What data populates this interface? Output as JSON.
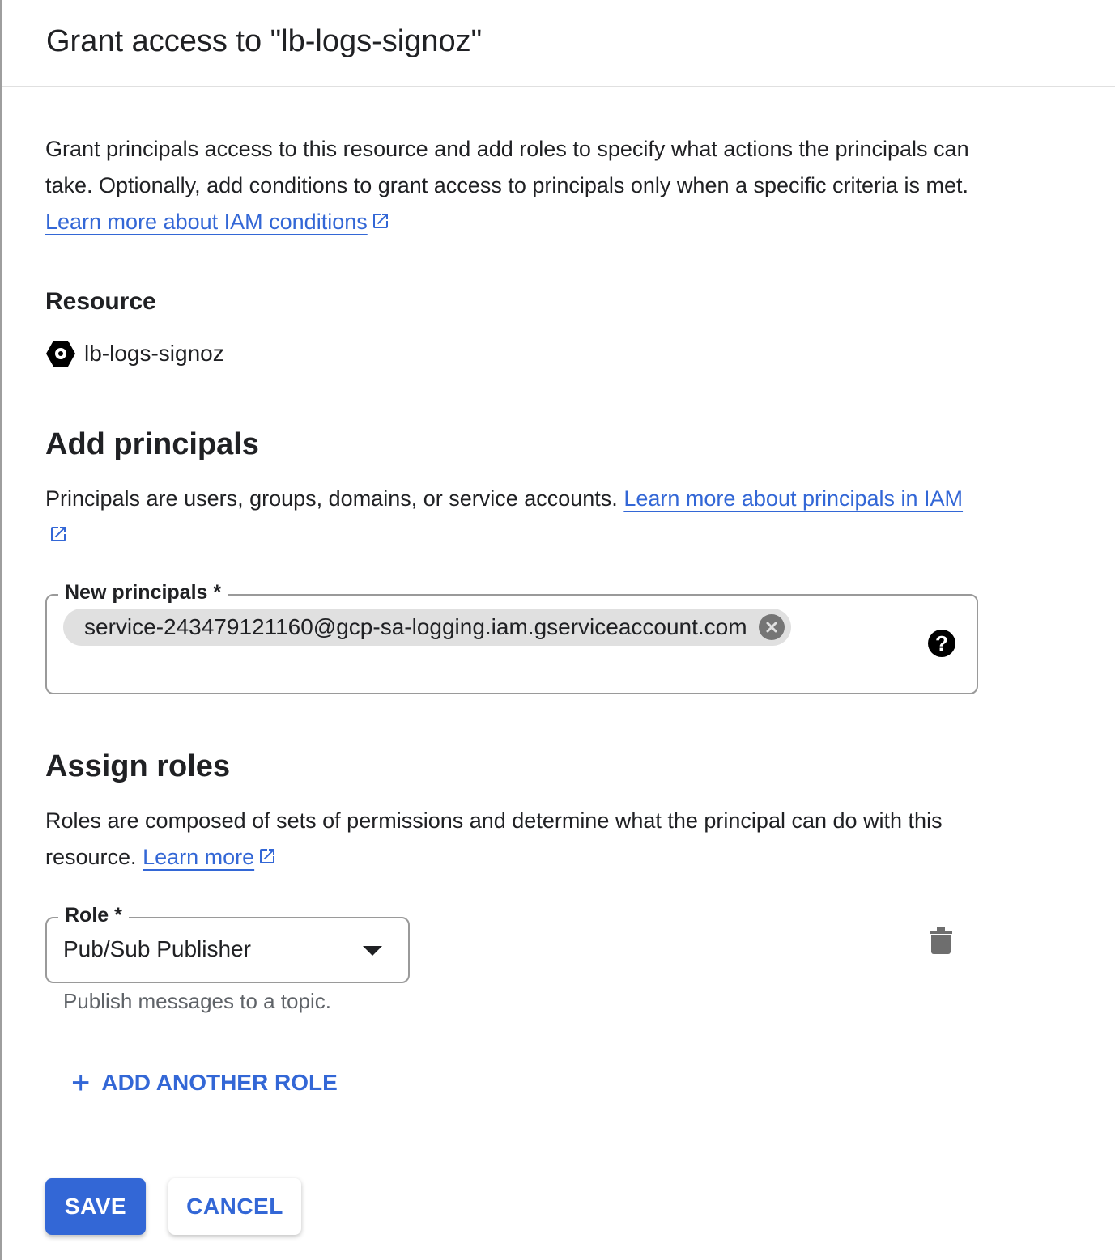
{
  "dialog": {
    "title": "Grant access to \"lb-logs-signoz\"",
    "intro_text": "Grant principals access to this resource and add roles to specify what actions the principals can take. Optionally, add conditions to grant access to principals only when a specific criteria is met. ",
    "intro_link": "Learn more about IAM conditions"
  },
  "resource": {
    "heading": "Resource",
    "name": "lb-logs-signoz",
    "icon": "pubsub-topic-hexagon-icon"
  },
  "principals": {
    "heading": "Add principals",
    "description": "Principals are users, groups, domains, or service accounts. ",
    "link": "Learn more about principals in IAM",
    "field_label": "New principals *",
    "chips": [
      "service-243479121160@gcp-sa-logging.iam.gserviceaccount.com"
    ],
    "help_glyph": "?"
  },
  "roles": {
    "heading": "Assign roles",
    "description": "Roles are composed of sets of permissions and determine what the principal can do with this resource. ",
    "link": "Learn more",
    "role_label": "Role *",
    "selected_role": "Pub/Sub Publisher",
    "role_hint": "Publish messages to a topic.",
    "add_another": "ADD ANOTHER ROLE",
    "add_glyph": "+"
  },
  "actions": {
    "save": "SAVE",
    "cancel": "CANCEL"
  },
  "colors": {
    "accent": "#3367d6",
    "text": "#202124",
    "hint": "#5f6368",
    "chip": "#e0e0e0"
  }
}
